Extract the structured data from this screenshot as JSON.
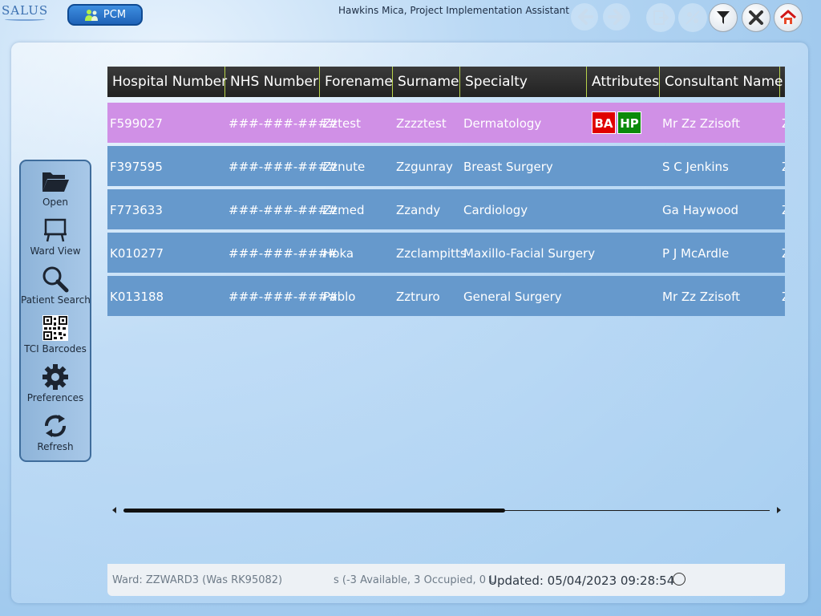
{
  "header": {
    "logo": "SALUS",
    "app_button": "PCM",
    "user": "Hawkins Mica, Project Implementation Assistant"
  },
  "sidebar": {
    "items": [
      {
        "label": "Open",
        "icon": "folder-open-icon"
      },
      {
        "label": "Ward View",
        "icon": "whiteboard-icon"
      },
      {
        "label": "Patient Search",
        "icon": "magnifier-icon"
      },
      {
        "label": "TCI Barcodes",
        "icon": "qr-code-icon"
      },
      {
        "label": "Preferences",
        "icon": "gear-icon"
      },
      {
        "label": "Refresh",
        "icon": "refresh-icon"
      }
    ]
  },
  "table": {
    "columns": [
      "Hospital Number",
      "NHS Number",
      "Forename",
      "Surname",
      "Specialty",
      "Attributes",
      "Consultant Name",
      "Z"
    ],
    "rows": [
      {
        "hospital": "F599027",
        "nhs": "###-###-####",
        "forename": "Zztest",
        "surname": "Zzzztest",
        "specialty": "Dermatology",
        "attr1": "BA",
        "attr2": "HP",
        "consultant": "Mr Zz Zzisoft",
        "extra": "Z",
        "selected": true
      },
      {
        "hospital": "F397595",
        "nhs": "###-###-####",
        "forename": "Zznute",
        "surname": "Zzgunray",
        "specialty": "Breast Surgery",
        "attr1": "",
        "attr2": "",
        "consultant": "S C Jenkins",
        "extra": "Z"
      },
      {
        "hospital": "F773633",
        "nhs": "###-###-####",
        "forename": "Zzmed",
        "surname": "Zzandy",
        "specialty": "Cardiology",
        "attr1": "",
        "attr2": "",
        "consultant": "Ga Haywood",
        "extra": "Z"
      },
      {
        "hospital": "K010277",
        "nhs": "###-###-####",
        "forename": "Hoka",
        "surname": "Zzclampitts",
        "specialty": "Maxillo-Facial Surgery",
        "attr1": "",
        "attr2": "",
        "consultant": "P J McArdle",
        "extra": "Z"
      },
      {
        "hospital": "K013188",
        "nhs": "###-###-####",
        "forename": "Pablo",
        "surname": "Zztruro",
        "specialty": "General Surgery",
        "attr1": "",
        "attr2": "",
        "consultant": "Mr Zz Zzisoft",
        "extra": "Z"
      }
    ]
  },
  "status": {
    "ward": "Ward: ZZWARD3 (Was RK95082)",
    "beds": "s (-3 Available, 3 Occupied, 0 U",
    "updated": "Updated: 05/04/2023 09:28:54"
  },
  "colors": {
    "row": "#6699cc",
    "selected_row": "#d090e6",
    "badge_ba": "#e00000",
    "badge_hp": "#0a8a0a"
  }
}
